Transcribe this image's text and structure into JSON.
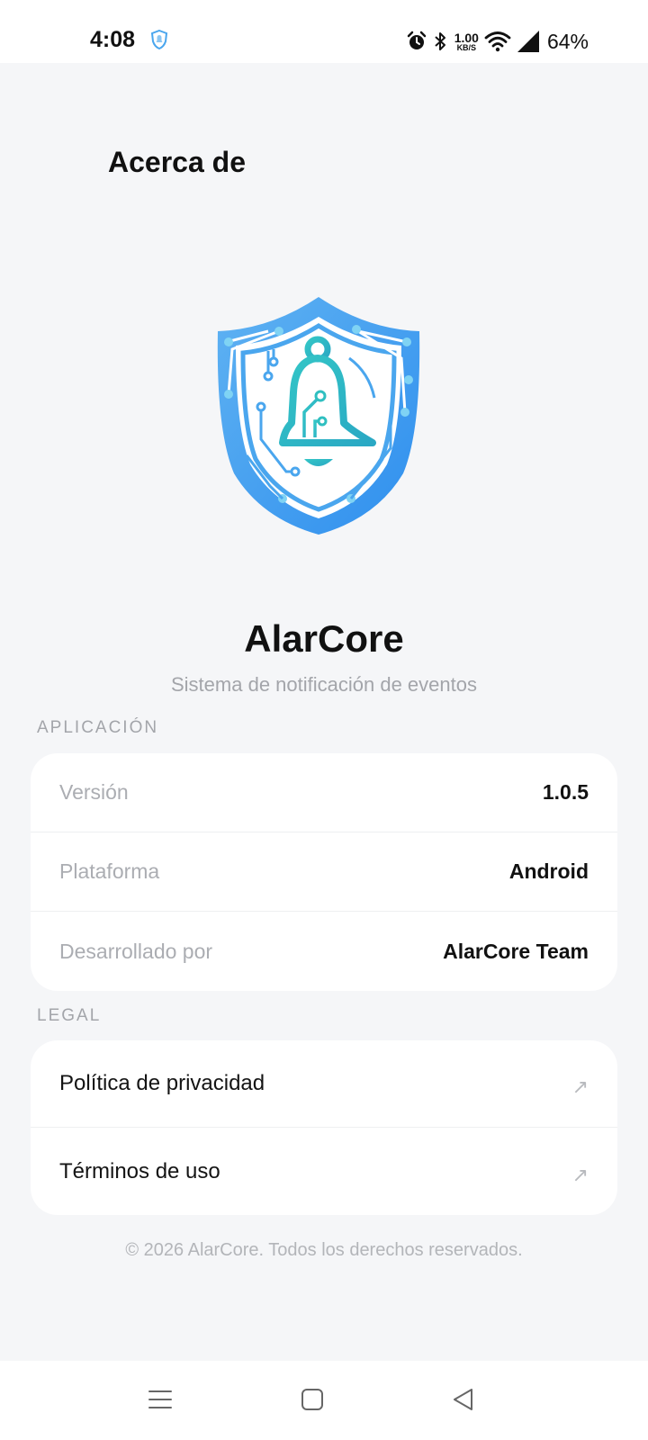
{
  "status_bar": {
    "time": "4:08",
    "app_icon": "shield-bell-icon",
    "alarm_icon": "alarm-icon",
    "bluetooth_icon": "bluetooth-icon",
    "net_speed_value": "1.00",
    "net_speed_unit": "KB/S",
    "wifi_icon": "wifi-icon",
    "signal_icon": "signal-icon",
    "battery": "64%"
  },
  "header": {
    "title": "Acerca de"
  },
  "app": {
    "logo_icon": "shield-bell-logo",
    "name": "AlarCore",
    "subtitle": "Sistema de notificación de eventos"
  },
  "sections": {
    "app_info": {
      "label": "APLICACIÓN",
      "rows": [
        {
          "key": "Versión",
          "value": "1.0.5"
        },
        {
          "key": "Plataforma",
          "value": "Android"
        },
        {
          "key": "Desarrollado por",
          "value": "AlarCore Team"
        }
      ]
    },
    "legal": {
      "label": "LEGAL",
      "links": [
        {
          "label": "Política de privacidad",
          "arrow": "↗"
        },
        {
          "label": "Términos de uso",
          "arrow": "↗"
        }
      ]
    }
  },
  "footer": {
    "copyright": "© 2026 AlarCore. Todos los derechos reservados."
  },
  "nav_bar": {
    "menu_icon": "menu-icon",
    "home_icon": "home-icon",
    "back_icon": "back-icon"
  },
  "colors": {
    "accent_blue": "#3d9ff0",
    "accent_teal": "#2fbfc0",
    "background": "#f5f6f8"
  }
}
